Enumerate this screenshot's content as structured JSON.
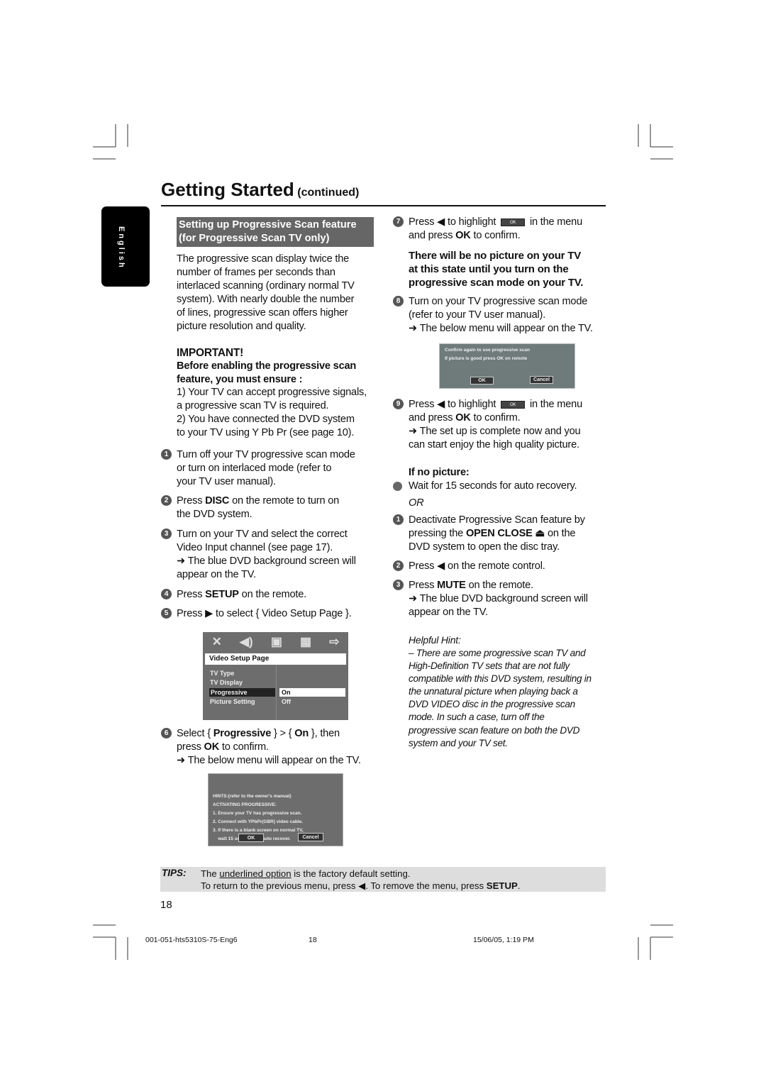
{
  "title": {
    "main": "Getting Started",
    "sub": "(continued)"
  },
  "language_tab": "English",
  "section_header": "Setting up Progressive Scan feature\n(for Progressive Scan TV only)",
  "left": {
    "intro": [
      [
        "The progressive scan display twice the\nnumber of frames per seconds than\ninterlaced scanning (ordinary normal TV\nsystem). With nearly double the number\nof lines, progressive scan offers higher\npicture resolution and quality.",
        ""
      ]
    ],
    "important": [
      [
        "IMPORTANT!",
        "b"
      ]
    ],
    "before": [
      [
        "Before enabling the progressive scan\nfeature, you must ensure :",
        "b"
      ]
    ],
    "list1": [
      [
        "1)  Your TV can accept progressive signals,\n      a progressive scan TV is required.",
        ""
      ]
    ],
    "list2": [
      [
        "2)  You have connected the DVD system\n      to your TV using Y Pb Pr (see page 10).",
        ""
      ]
    ],
    "steps": [
      {
        "n": "1",
        "rich": [
          [
            "Turn off your TV progressive scan mode\nor turn on interlaced mode (refer to\nyour TV user manual).",
            ""
          ]
        ]
      },
      {
        "n": "2",
        "rich": [
          [
            "Press ",
            ""
          ],
          [
            "DISC",
            "b"
          ],
          [
            " on the remote to turn on\nthe DVD system.",
            ""
          ]
        ]
      },
      {
        "n": "3",
        "rich": [
          [
            "Turn on your TV and select the correct\nVideo Input channel (see page 17).\n➜ The blue DVD background screen will\nappear on the TV.",
            ""
          ]
        ]
      },
      {
        "n": "4",
        "rich": [
          [
            "Press ",
            ""
          ],
          [
            "SETUP",
            "b"
          ],
          [
            " on the remote.",
            ""
          ]
        ]
      },
      {
        "n": "5",
        "rich": [
          [
            "Press ▶ to select { Video Setup Page }.",
            ""
          ]
        ]
      },
      {
        "n": "6",
        "rich": [
          [
            "Select { ",
            ""
          ],
          [
            "Progressive",
            "b"
          ],
          [
            " } > { ",
            ""
          ],
          [
            "On",
            "b"
          ],
          [
            " }, then\npress ",
            ""
          ],
          [
            "OK",
            "b"
          ],
          [
            " to confirm.\n➜ The below menu will appear on the TV.",
            ""
          ]
        ]
      }
    ]
  },
  "video_setup_menu": {
    "icons": [
      "setup-tools-icon",
      "speaker-icon",
      "video-icon",
      "preference-icon",
      "exit-icon"
    ],
    "page": "Video Setup Page",
    "items": [
      "TV Type",
      "TV Display",
      "Progressive",
      "Picture Setting"
    ],
    "options": [
      "On",
      "Off"
    ],
    "selected_item": "Progressive",
    "selected_option": "On"
  },
  "hints_menu": {
    "lines": [
      "HINTS:(refer to the owner's manual)",
      "ACTIVATING PROGRESSIVE:",
      "1. Ensure your TV has progressive scan.",
      "2. Connect with YPbPr(GBR) video cable.",
      "3. If there is a blank screen on normal TV,",
      "    wait 15 seconds for auto recover."
    ],
    "ok": "OK",
    "cancel": "Cancel"
  },
  "confirm_menu": {
    "lines": [
      "Confirm again to use progressive scan",
      "If picture is good press OK on remote"
    ],
    "ok": "OK",
    "cancel": "Cancel"
  },
  "ok_chip": "OK",
  "right": {
    "step7a": "Press ◀ to highlight ",
    "step7b": " in the menu\nand press ",
    "step7c": "OK",
    "step7d": " to confirm.",
    "warning": [
      [
        "There will be no picture on your TV\nat this state until you turn on the\nprogressive scan mode on your TV.",
        "b"
      ]
    ],
    "step8": [
      [
        "Turn on your TV progressive scan mode\n(refer to your TV user manual).\n➜ The below menu will appear on the TV.",
        ""
      ]
    ],
    "step9b": " in the menu\nand press ",
    "step9d": " to confirm.\n➜ The set up is complete now and you\ncan start enjoy the high quality picture.",
    "no_picture": "If no picture:",
    "bullet": "Wait for 15 seconds for auto recovery.",
    "or": "OR",
    "r1": [
      [
        "Deactivate Progressive Scan feature by\npressing the ",
        ""
      ],
      [
        "OPEN CLOSE ⏏",
        "b"
      ],
      [
        " on the\nDVD system to open the disc tray.",
        ""
      ]
    ],
    "r2": [
      [
        "Press ◀ on the remote control.",
        ""
      ]
    ],
    "r3": [
      [
        "Press ",
        ""
      ],
      [
        "MUTE",
        "b"
      ],
      [
        " on the remote.\n➜ The blue DVD background screen will\nappear on the TV.",
        ""
      ]
    ],
    "hint_title": "Helpful Hint:",
    "hint": "–  There are some progressive scan TV and\nHigh-Definition TV sets that are not fully\ncompatible with this DVD system, resulting in\nthe unnatural picture when playing back a\nDVD VIDEO disc in the progressive scan\nmode.  In such a case, turn off the\nprogressive scan feature on both the DVD\nsystem and your TV set."
  },
  "tips": {
    "label": "TIPS:",
    "line1": [
      [
        "The ",
        ""
      ],
      [
        "underlined option",
        "u"
      ],
      [
        " is the factory default setting.",
        ""
      ]
    ],
    "line2": [
      [
        "To return to the previous menu, press ◀.  To remove the menu, press ",
        ""
      ],
      [
        "SETUP",
        "b"
      ],
      [
        ".",
        ""
      ]
    ]
  },
  "page_number": "18",
  "footer": {
    "file": "001-051-hts5310S-75-Eng6",
    "page": "18",
    "date": "15/06/05, 1:19 PM"
  }
}
